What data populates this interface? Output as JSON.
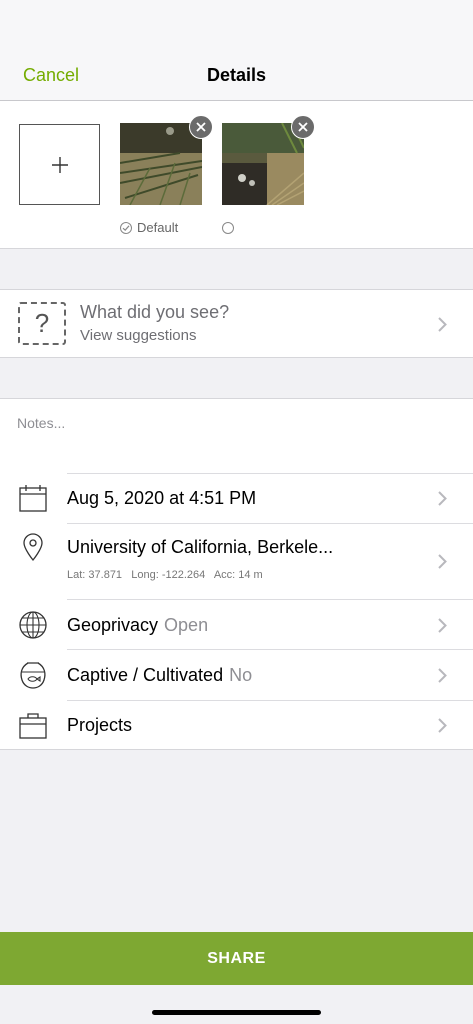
{
  "nav": {
    "cancel": "Cancel",
    "title": "Details"
  },
  "photos": {
    "add_icon": "plus-icon",
    "default_label": "Default"
  },
  "species": {
    "title": "What did you see?",
    "subtitle": "View suggestions",
    "icon": "question-mark-icon"
  },
  "notes": {
    "placeholder": "Notes..."
  },
  "rows": {
    "date": {
      "label": "Aug 5, 2020 at 4:51 PM",
      "icon": "calendar-icon"
    },
    "location": {
      "label": "University of California, Berkele...",
      "lat": "Lat: 37.871",
      "long": "Long: -122.264",
      "acc": "Acc: 14 m",
      "icon": "map-pin-icon"
    },
    "geoprivacy": {
      "label": "Geoprivacy",
      "value": "Open",
      "icon": "globe-icon"
    },
    "captive": {
      "label": "Captive / Cultivated",
      "value": "No",
      "icon": "fishbowl-icon"
    },
    "projects": {
      "label": "Projects",
      "icon": "briefcase-icon"
    }
  },
  "share": {
    "label": "SHARE"
  },
  "colors": {
    "accent": "#74ac00",
    "share_bg": "#7ea832"
  }
}
